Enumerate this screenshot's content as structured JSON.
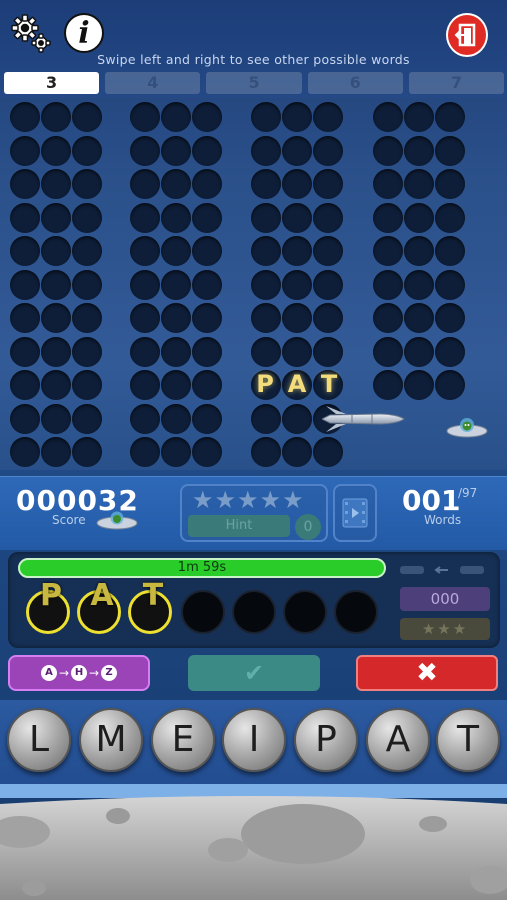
{
  "header": {
    "subtitle": "Swipe left and right to see other possible words",
    "settings_icon": "gear-icon",
    "info_icon": "info-icon",
    "info_glyph": "i",
    "exit_icon": "exit-door-icon"
  },
  "tabs": [
    {
      "label": "3",
      "active": true
    },
    {
      "label": "4",
      "active": false
    },
    {
      "label": "5",
      "active": false
    },
    {
      "label": "6",
      "active": false
    },
    {
      "label": "7",
      "active": false
    }
  ],
  "word_grid": {
    "rows": 11,
    "columns": 4,
    "letters_per_word": 3,
    "current_word": [
      "P",
      "A",
      "T"
    ]
  },
  "stats": {
    "score": "000032",
    "score_label": "Score",
    "words_found": "001",
    "words_total": "/97",
    "words_label": "Words",
    "hint_label": "Hint",
    "hint_count": "0",
    "stars": "★★★★★"
  },
  "play": {
    "timer": "1m 59s",
    "timer_fraction": 0.97,
    "slots": [
      "P",
      "A",
      "T",
      "",
      "",
      "",
      ""
    ],
    "bonus_value": "000",
    "bonus_stars": "★★★"
  },
  "controls": {
    "sort_letters": [
      "A",
      "H",
      "Z"
    ],
    "sort_arrow": "→",
    "confirm_glyph": "✔",
    "clear_glyph": "✖"
  },
  "tiles": [
    "L",
    "M",
    "E",
    "I",
    "P",
    "A",
    "T"
  ],
  "colors": {
    "timer_bar": "#2acc2a",
    "slot_ring": "#ede030",
    "clear_button": "#d4282a",
    "sort_button": "#9a44b8"
  }
}
